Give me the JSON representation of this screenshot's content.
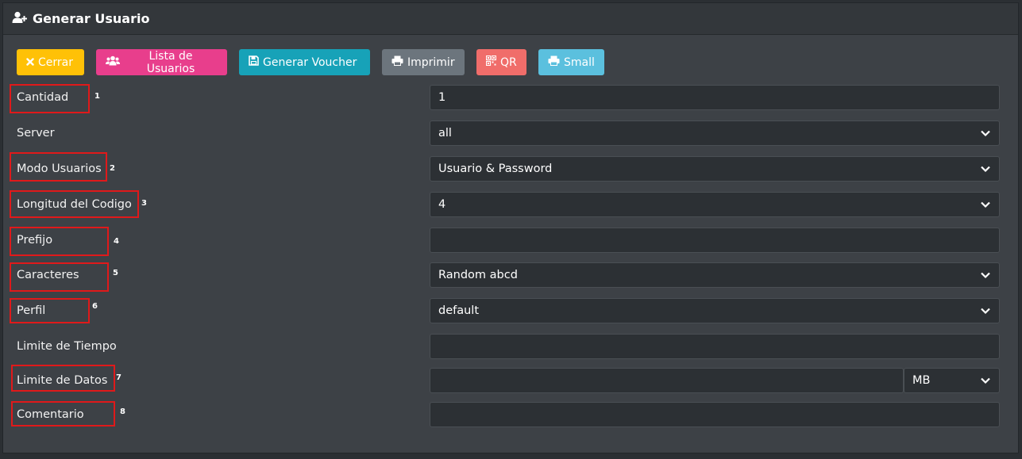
{
  "header": {
    "title": "Generar Usuario",
    "icon": "user-plus-icon"
  },
  "toolbar": {
    "close_label": "Cerrar",
    "list_label": "Lista de Usuarios",
    "voucher_label": "Generar Voucher",
    "print_label": "Imprimir",
    "qr_label": "QR",
    "small_label": "Small"
  },
  "form": {
    "cantidad": {
      "label": "Cantidad",
      "value": "1",
      "marker": "1"
    },
    "server": {
      "label": "Server",
      "value": "all"
    },
    "modo": {
      "label": "Modo Usuarios",
      "value": "Usuario & Password",
      "marker": "2"
    },
    "longitud": {
      "label": "Longitud del Codigo",
      "value": "4",
      "marker": "3"
    },
    "prefijo": {
      "label": "Prefijo",
      "value": "",
      "marker": "4"
    },
    "caracteres": {
      "label": "Caracteres",
      "value": "Random abcd",
      "marker": "5"
    },
    "perfil": {
      "label": "Perfil",
      "value": "default",
      "marker": "6"
    },
    "tiempo": {
      "label": "Limite de Tiempo",
      "value": ""
    },
    "datos": {
      "label": "Limite de Datos",
      "value": "",
      "unit": "MB",
      "marker": "7"
    },
    "comentario": {
      "label": "Comentario",
      "value": "",
      "marker": "8"
    }
  },
  "colors": {
    "annotation": "#e0191a",
    "close": "#ffc107",
    "list": "#e83e8c",
    "voucher": "#17a2b8",
    "print": "#6c757d",
    "qr": "#f06d6a",
    "small": "#5bc0de"
  }
}
